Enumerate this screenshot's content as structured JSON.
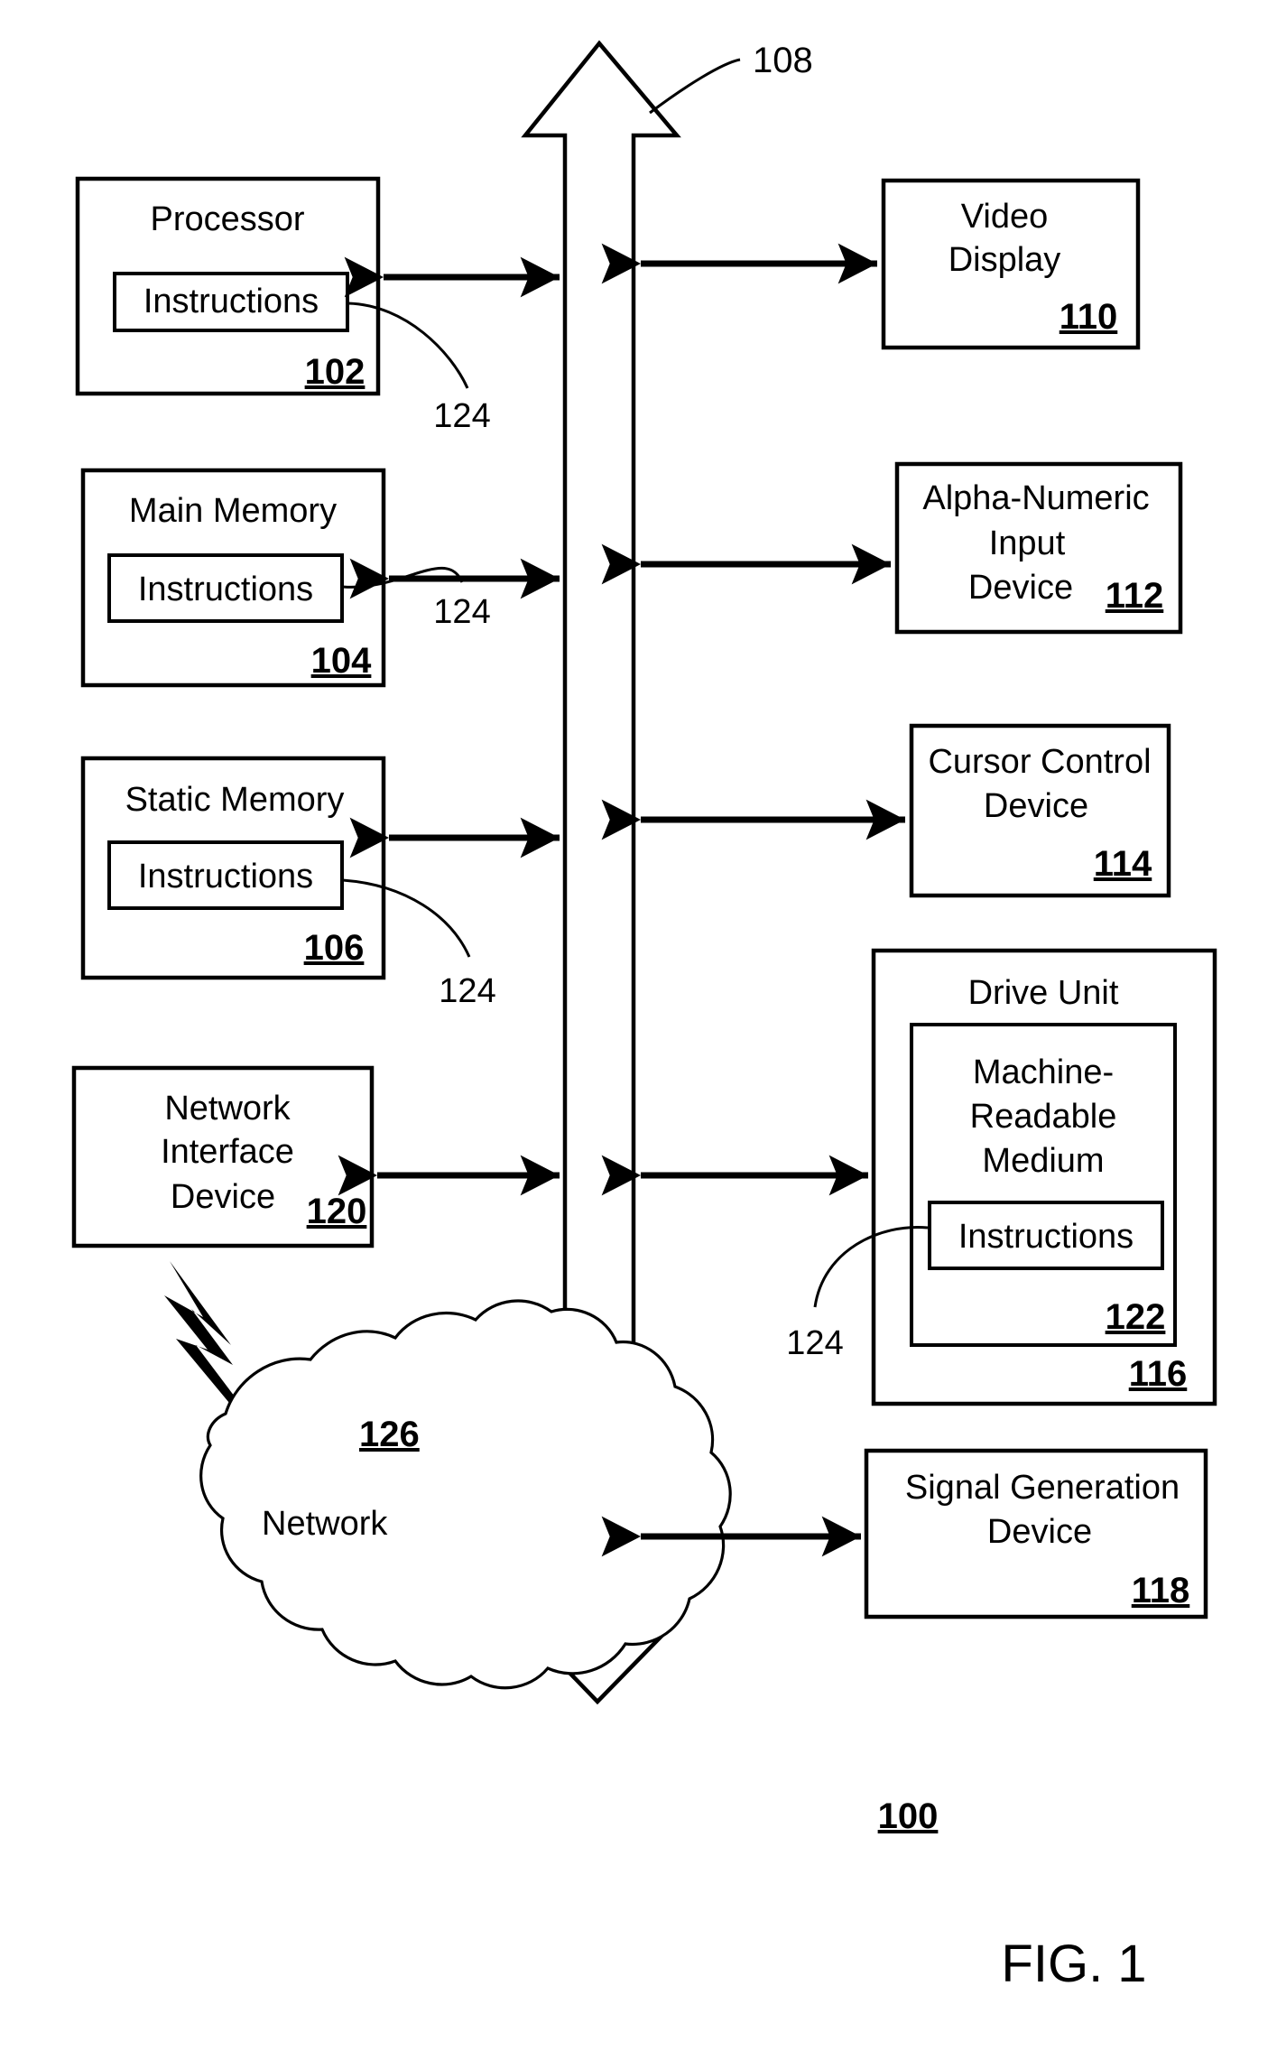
{
  "figure": {
    "title": "FIG. 1",
    "system_ref": "100",
    "bus_ref": "108"
  },
  "blocks": {
    "processor": {
      "label": "Processor",
      "ref": "102",
      "inner_label": "Instructions",
      "inner_ref": "124"
    },
    "main_memory": {
      "label": "Main Memory",
      "ref": "104",
      "inner_label": "Instructions",
      "inner_ref": "124"
    },
    "static_memory": {
      "label": "Static Memory",
      "ref": "106",
      "inner_label": "Instructions",
      "inner_ref": "124"
    },
    "network_interface_device": {
      "label_line1": "Network",
      "label_line2": "Interface",
      "label_line3": "Device",
      "ref": "120"
    },
    "video_display": {
      "label_line1": "Video",
      "label_line2": "Display",
      "ref": "110"
    },
    "alpha_numeric_input_device": {
      "label_line1": "Alpha-Numeric",
      "label_line2": "Input",
      "label_line3": "Device",
      "ref": "112"
    },
    "cursor_control_device": {
      "label_line1": "Cursor Control",
      "label_line2": "Device",
      "ref": "114"
    },
    "drive_unit": {
      "label": "Drive Unit",
      "ref": "116",
      "medium": {
        "label_line1": "Machine-",
        "label_line2": "Readable",
        "label_line3": "Medium",
        "ref": "122",
        "inner_label": "Instructions",
        "inner_ref": "124"
      }
    },
    "signal_generation_device": {
      "label_line1": "Signal Generation",
      "label_line2": "Device",
      "ref": "118"
    },
    "network": {
      "label": "Network",
      "ref": "126"
    }
  }
}
